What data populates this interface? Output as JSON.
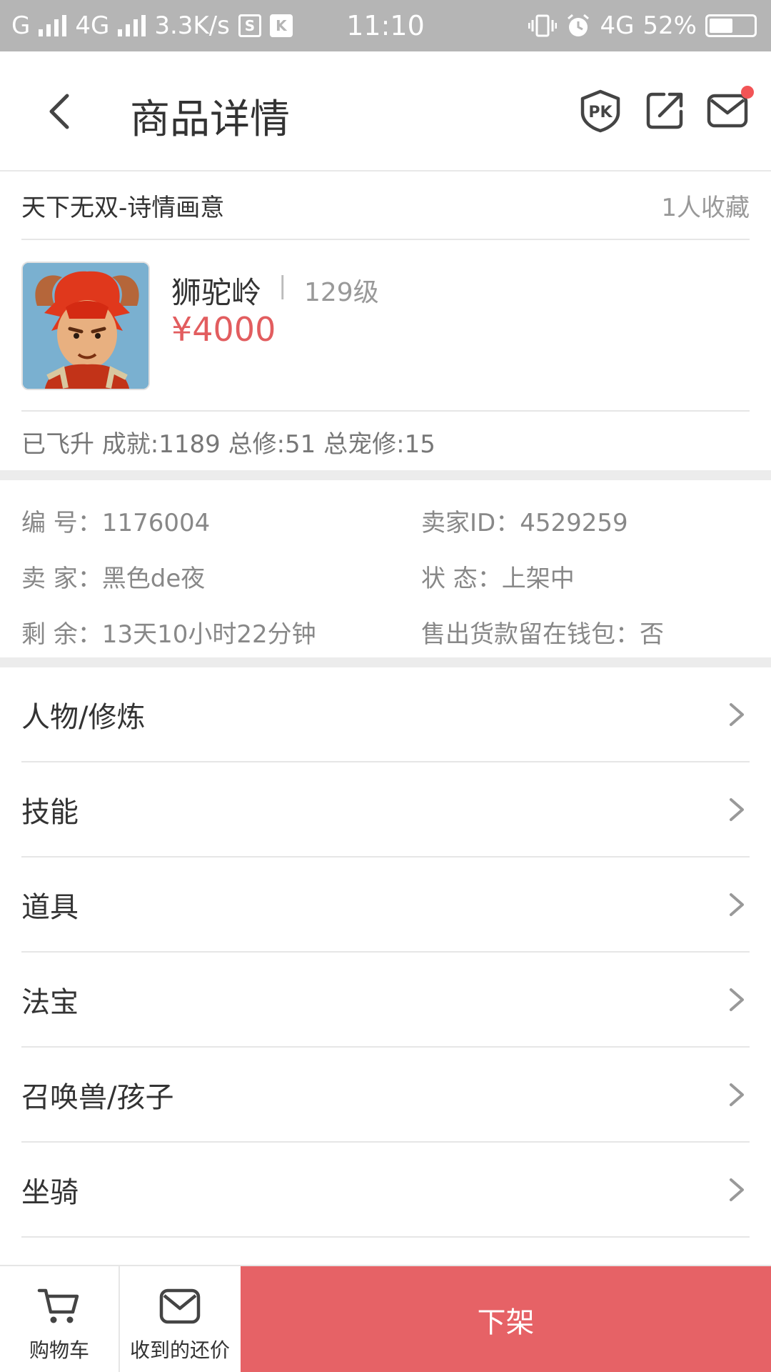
{
  "status_bar": {
    "carrier1": "G",
    "carrier2": "4G",
    "speed": "3.3K/s",
    "time": "11:10",
    "network": "4G",
    "battery": "52%"
  },
  "header": {
    "title": "商品详情",
    "icons": [
      "back-icon",
      "pk-icon",
      "share-icon",
      "mail-icon"
    ]
  },
  "shop": {
    "name": "天下无双-诗情画意",
    "favorites": "1人收藏"
  },
  "product": {
    "name": "狮驼岭",
    "separator": "|",
    "level": "129级",
    "price": "¥4000",
    "stats": "已飞升 成就:1189 总修:51 总宠修:15"
  },
  "info": {
    "id": "编  号：1176004",
    "seller_id": "卖家ID：4529259",
    "seller": "卖  家：黑色de夜",
    "status": "状  态：上架中",
    "remaining": "剩  余：13天10小时22分钟",
    "wallet": "售出货款留在钱包：否"
  },
  "menu": [
    {
      "label": "人物/修炼"
    },
    {
      "label": "技能"
    },
    {
      "label": "道具"
    },
    {
      "label": "法宝"
    },
    {
      "label": "召唤兽/孩子"
    },
    {
      "label": "坐骑"
    }
  ],
  "bottom": {
    "cart_label": "购物车",
    "offers_label": "收到的还价",
    "delist_label": "下架"
  },
  "colors": {
    "accent": "#e66266",
    "price": "#e25d5f",
    "status_bar": "#b5b5b5"
  }
}
